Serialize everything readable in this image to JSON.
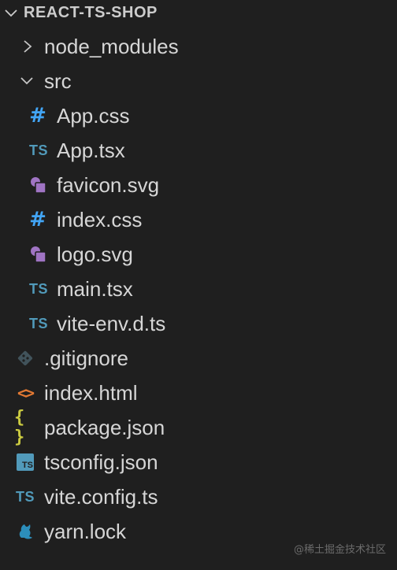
{
  "explorer": {
    "root": {
      "label": "REACT-TS-SHOP"
    },
    "items": [
      {
        "label": "node_modules",
        "icon": "chevron-right-icon"
      },
      {
        "label": "src",
        "icon": "chevron-down-icon"
      },
      {
        "label": "App.css",
        "icon": "css-hash-icon",
        "icon_text": "#"
      },
      {
        "label": "App.tsx",
        "icon": "typescript-icon",
        "icon_text": "TS"
      },
      {
        "label": "favicon.svg",
        "icon": "svg-shapes-icon"
      },
      {
        "label": "index.css",
        "icon": "css-hash-icon",
        "icon_text": "#"
      },
      {
        "label": "logo.svg",
        "icon": "svg-shapes-icon"
      },
      {
        "label": "main.tsx",
        "icon": "typescript-icon",
        "icon_text": "TS"
      },
      {
        "label": "vite-env.d.ts",
        "icon": "typescript-icon",
        "icon_text": "TS"
      },
      {
        "label": ".gitignore",
        "icon": "git-icon"
      },
      {
        "label": "index.html",
        "icon": "html-icon",
        "icon_text": "<>"
      },
      {
        "label": "package.json",
        "icon": "json-braces-icon",
        "icon_text": "{ }"
      },
      {
        "label": "tsconfig.json",
        "icon": "tsconfig-icon",
        "icon_text": "TS"
      },
      {
        "label": "vite.config.ts",
        "icon": "typescript-icon",
        "icon_text": "TS"
      },
      {
        "label": "yarn.lock",
        "icon": "yarn-icon"
      }
    ]
  },
  "watermark": "@稀土掘金技术社区",
  "colors": {
    "background": "#1f1f1f",
    "text": "#d6d6d6",
    "typescript": "#519aba",
    "css": "#42a5f5",
    "svg": "#a074c4",
    "git": "#41535b",
    "html": "#e37933",
    "json": "#cbcb41",
    "yarn": "#2c8ebb"
  }
}
